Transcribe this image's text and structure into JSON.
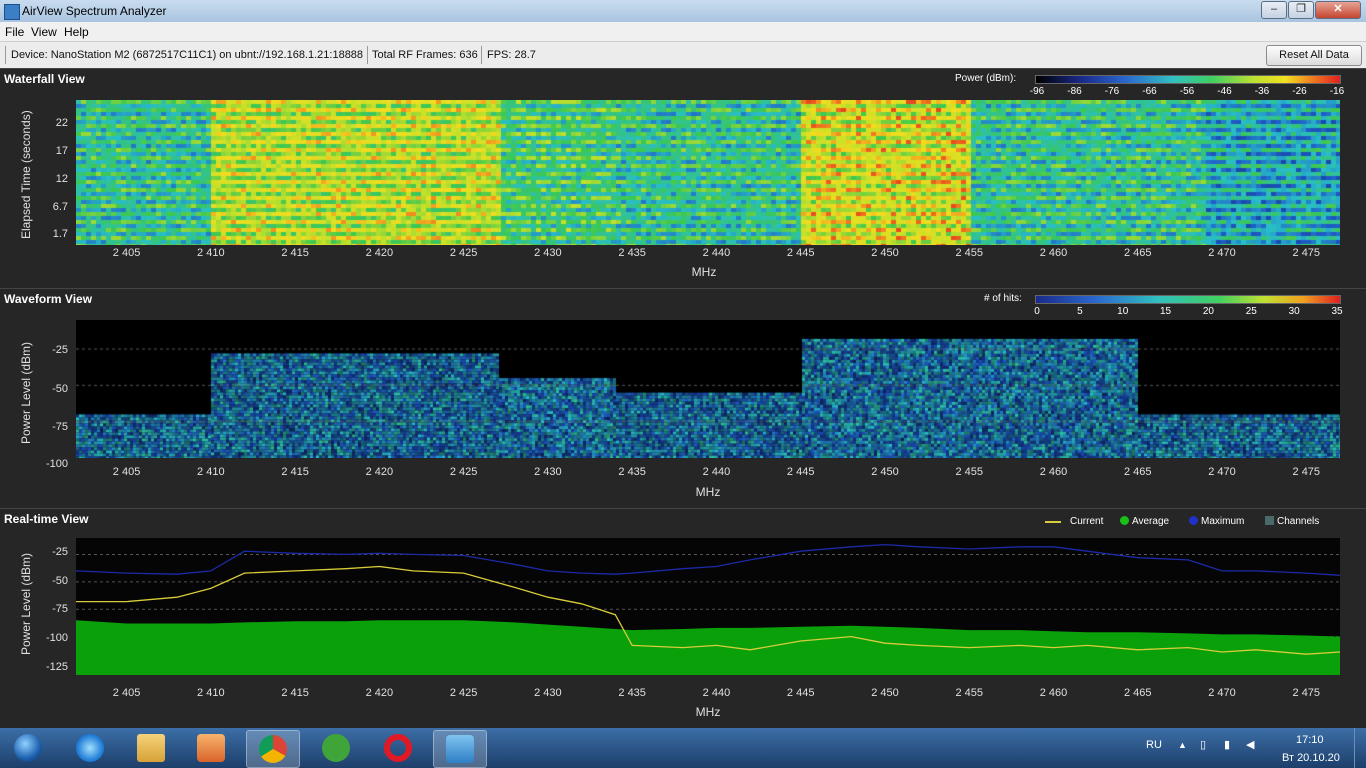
{
  "window": {
    "title": "AirView Spectrum Analyzer",
    "controls": {
      "minimize": "–",
      "maximize": "❐",
      "close": "✕"
    }
  },
  "menu": {
    "items": [
      "File",
      "View",
      "Help"
    ]
  },
  "info": {
    "device": "Device: NanoStation M2 (6872517C11C1) on ubnt://192.168.1.21:18888",
    "frames": "Total RF Frames: 636",
    "fps": "FPS: 28.7",
    "reset_label": "Reset All Data"
  },
  "x_ticks": [
    "2 405",
    "2 410",
    "2 415",
    "2 420",
    "2 425",
    "2 430",
    "2 435",
    "2 440",
    "2 445",
    "2 450",
    "2 455",
    "2 460",
    "2 465",
    "2 470",
    "2 475"
  ],
  "x_range": [
    2402,
    2477
  ],
  "waterfall": {
    "title": "Waterfall View",
    "legend_label": "Power (dBm):",
    "legend_ticks": [
      "-96",
      "-86",
      "-76",
      "-66",
      "-56",
      "-46",
      "-36",
      "-26",
      "-16"
    ],
    "ylabel": "Elapsed Time (seconds)",
    "yticks": [
      "22",
      "17",
      "12",
      "6.7",
      "1.7"
    ],
    "xlabel": "MHz"
  },
  "waveform": {
    "title": "Waveform View",
    "legend_label": "# of hits:",
    "legend_ticks": [
      "0",
      "5",
      "10",
      "15",
      "20",
      "25",
      "30",
      "35"
    ],
    "ylabel": "Power Level (dBm)",
    "yticks": [
      "-25",
      "-50",
      "-75",
      "-100"
    ],
    "xlabel": "MHz"
  },
  "realtime": {
    "title": "Real-time View",
    "legend": [
      {
        "label": "Current",
        "color": "#d8cc3a"
      },
      {
        "label": "Average",
        "color": "#18c018"
      },
      {
        "label": "Maximum",
        "color": "#2030c8"
      },
      {
        "label": "Channels",
        "color": "#4a6a6a"
      }
    ],
    "ylabel": "Power Level (dBm)",
    "yticks": [
      "-25",
      "-50",
      "-75",
      "-100",
      "-125"
    ],
    "xlabel": "MHz"
  },
  "colors": {
    "plot_bg": "#050505",
    "panel_bg": "#262626",
    "average": "#0aa00a",
    "maximum": "#1c2aa8",
    "current": "#d8cc3a"
  },
  "chart_data": [
    {
      "type": "heatmap",
      "title": "Waterfall View",
      "xlabel": "MHz",
      "ylabel": "Elapsed Time (seconds)",
      "xlim": [
        2402,
        2477
      ],
      "ylim": [
        0,
        24
      ],
      "zlabel": "Power (dBm)",
      "zlim": [
        -96,
        -16
      ]
    },
    {
      "type": "heatmap",
      "title": "Waveform View",
      "xlabel": "MHz",
      "ylabel": "Power Level (dBm)",
      "xlim": [
        2402,
        2477
      ],
      "ylim": [
        -100,
        -5
      ],
      "zlabel": "# of hits",
      "zlim": [
        0,
        38
      ]
    },
    {
      "type": "area",
      "title": "Real-time View",
      "xlabel": "MHz",
      "ylabel": "Power Level (dBm)",
      "xlim": [
        2402,
        2477
      ],
      "ylim": [
        -135,
        -10
      ],
      "x": [
        2402,
        2405,
        2408,
        2410,
        2412,
        2415,
        2418,
        2420,
        2422,
        2425,
        2428,
        2430,
        2432,
        2434,
        2435,
        2438,
        2440,
        2442,
        2445,
        2448,
        2450,
        2452,
        2455,
        2458,
        2460,
        2462,
        2465,
        2468,
        2470,
        2472,
        2475,
        2477
      ],
      "series": [
        {
          "name": "Current",
          "values": [
            -68,
            -68,
            -64,
            -56,
            -42,
            -40,
            -38,
            -36,
            -40,
            -42,
            -55,
            -64,
            -70,
            -80,
            -108,
            -110,
            -108,
            -112,
            -104,
            -100,
            -106,
            -108,
            -110,
            -108,
            -110,
            -108,
            -112,
            -110,
            -114,
            -112,
            -116,
            -114
          ]
        },
        {
          "name": "Average",
          "values": [
            -85,
            -88,
            -88,
            -88,
            -87,
            -86,
            -86,
            -85,
            -85,
            -85,
            -87,
            -89,
            -91,
            -93,
            -94,
            -93,
            -92,
            -92,
            -91,
            -90,
            -91,
            -92,
            -94,
            -94,
            -95,
            -96,
            -96,
            -97,
            -98,
            -98,
            -99,
            -100
          ]
        },
        {
          "name": "Maximum",
          "values": [
            -40,
            -42,
            -43,
            -40,
            -22,
            -24,
            -25,
            -24,
            -25,
            -26,
            -34,
            -40,
            -42,
            -43,
            -42,
            -38,
            -36,
            -30,
            -22,
            -18,
            -16,
            -18,
            -20,
            -18,
            -18,
            -22,
            -28,
            -30,
            -40,
            -40,
            -42,
            -44
          ]
        }
      ]
    }
  ],
  "taskbar": {
    "lang": "RU",
    "time": "17:10",
    "date": "Вт 20.10.20",
    "items": [
      "start-orb-icon",
      "internet-explorer-icon",
      "file-explorer-icon",
      "media-player-icon",
      "chrome-icon",
      "utorrent-icon",
      "opera-icon",
      "airview-icon"
    ]
  }
}
